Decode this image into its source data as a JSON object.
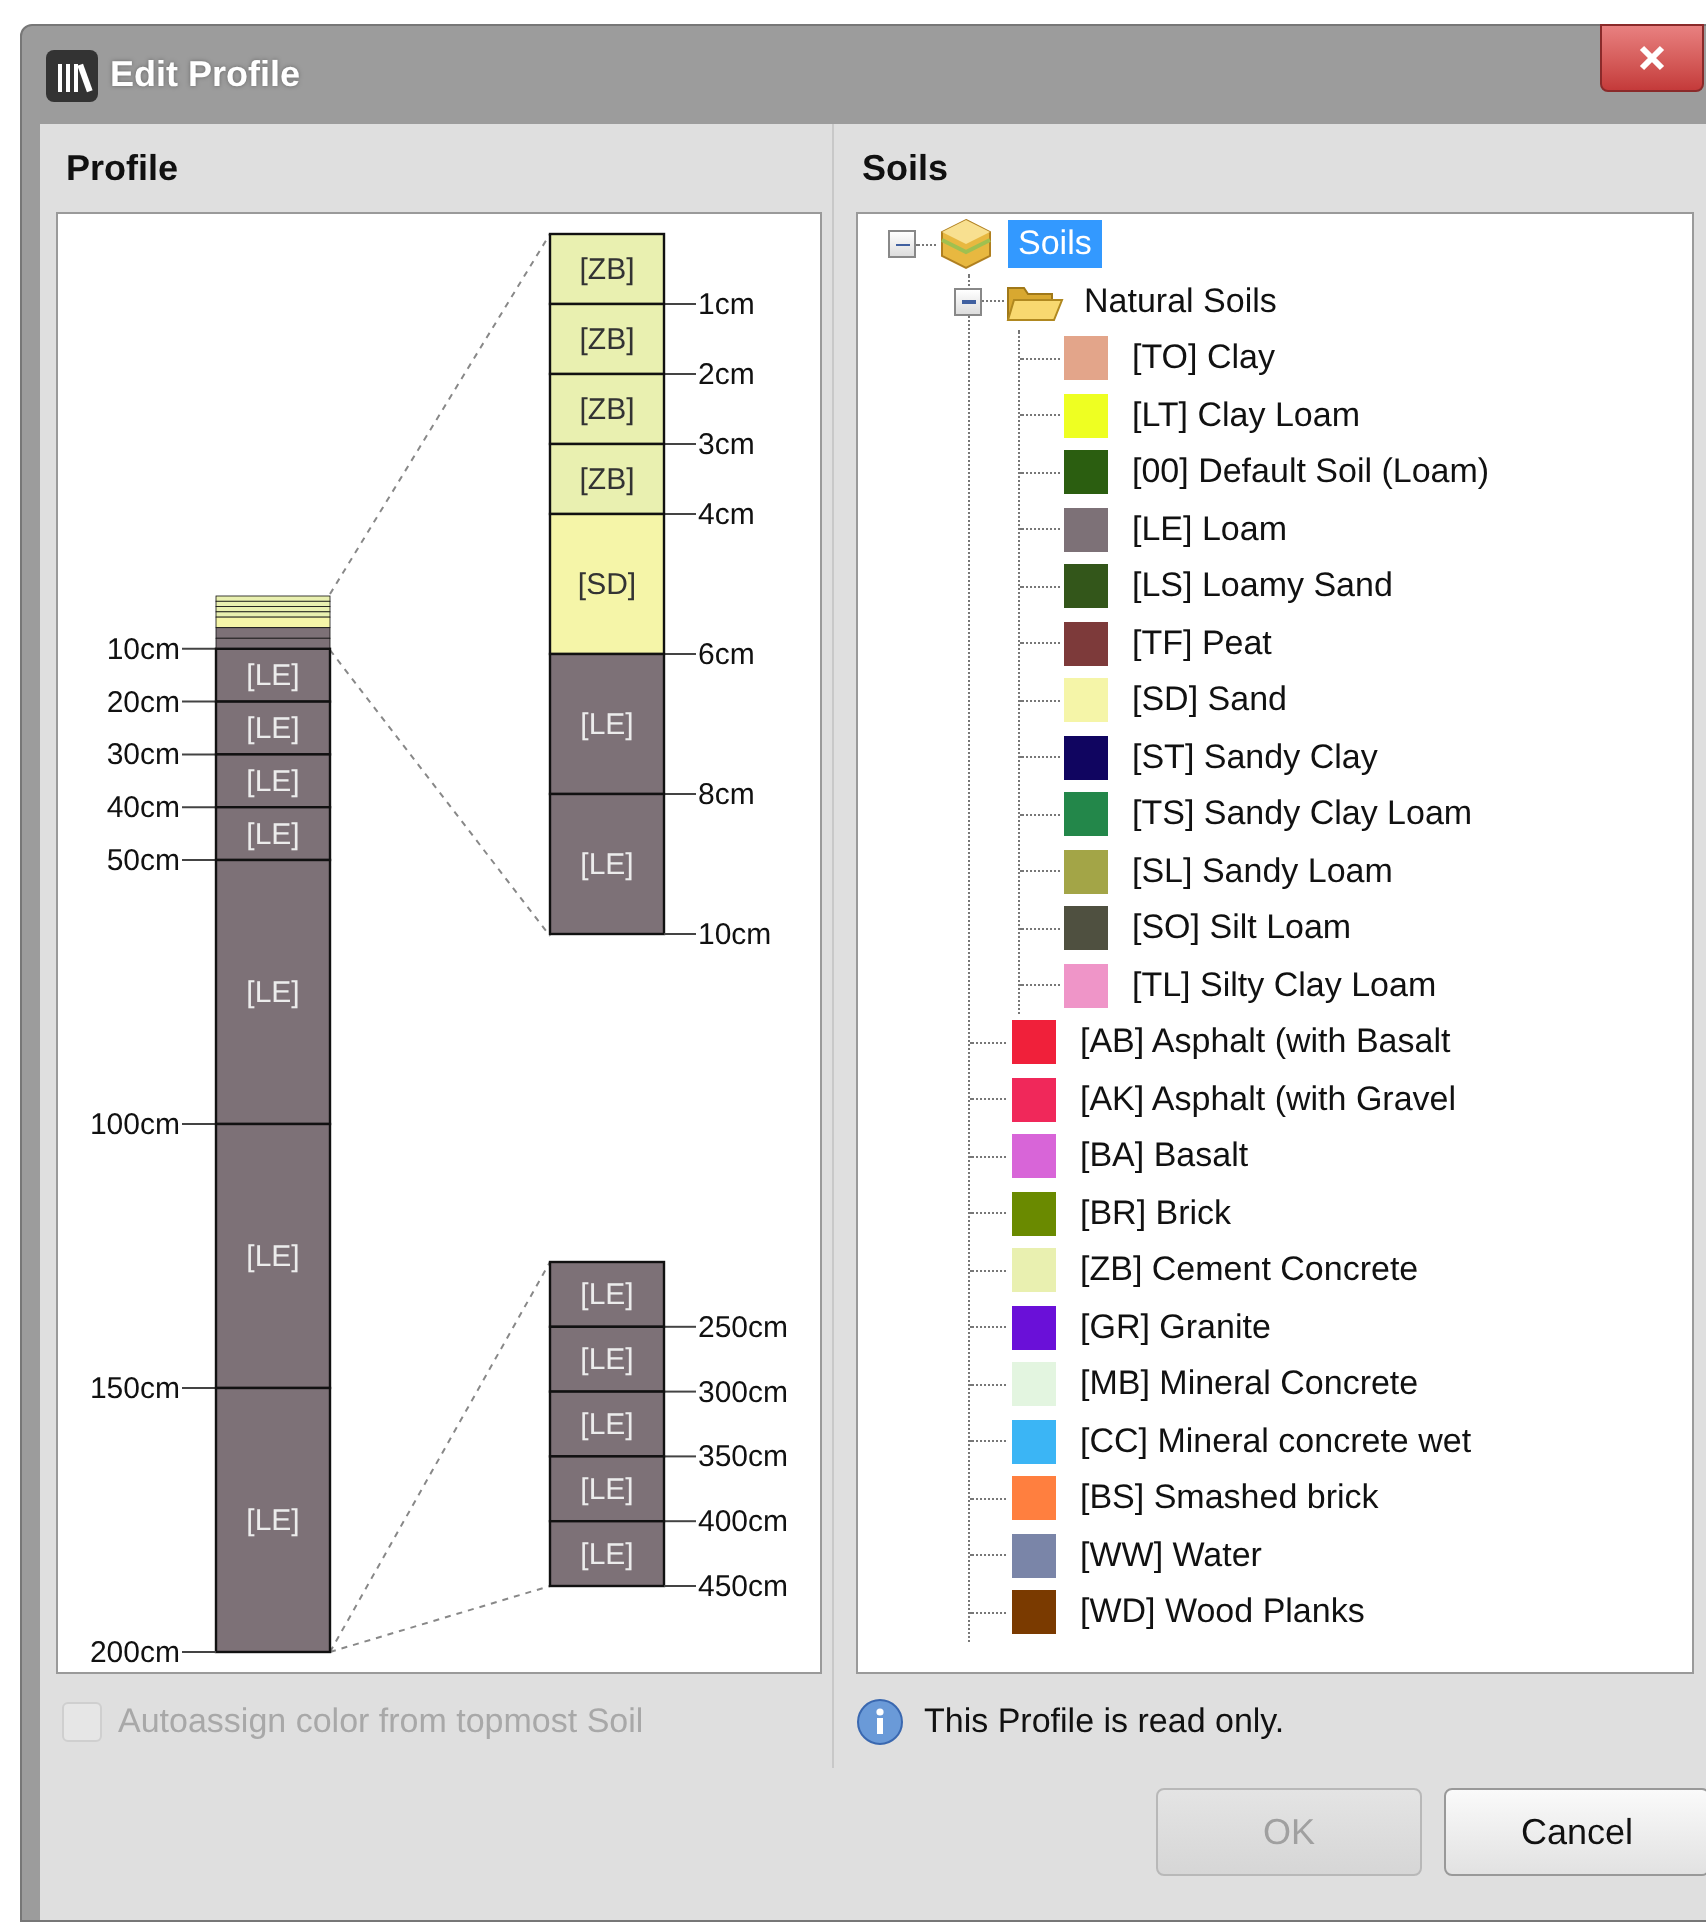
{
  "window": {
    "title": "Edit Profile"
  },
  "profile": {
    "title": "Profile",
    "column": {
      "layers": [
        {
          "color": "#e9f0b0"
        },
        {
          "color": "#e9f0b0"
        },
        {
          "color": "#e9f0b0"
        },
        {
          "color": "#e9f0b0"
        },
        {
          "color": "#f5f5a8"
        },
        {
          "color": "#7d7177"
        },
        {
          "color": "#7d7177",
          "depth": "10cm"
        },
        {
          "color": "#7d7177",
          "label": "[LE]",
          "depth": "20cm"
        },
        {
          "color": "#7d7177",
          "label": "[LE]",
          "depth": "30cm"
        },
        {
          "color": "#7d7177",
          "label": "[LE]",
          "depth": "40cm"
        },
        {
          "color": "#7d7177",
          "label": "[LE]",
          "depth": "50cm"
        },
        {
          "color": "#7d7177",
          "label": "[LE]",
          "depth": "100cm"
        },
        {
          "color": "#7d7177",
          "label": "[LE]",
          "depth": "150cm"
        },
        {
          "color": "#7d7177",
          "label": "[LE]",
          "depth": "200cm"
        }
      ]
    },
    "detail_top": {
      "layers": [
        {
          "color": "#e9f0b0",
          "label": "[ZB]",
          "depth": "1cm"
        },
        {
          "color": "#e9f0b0",
          "label": "[ZB]",
          "depth": "2cm"
        },
        {
          "color": "#e9f0b0",
          "label": "[ZB]",
          "depth": "3cm"
        },
        {
          "color": "#e9f0b0",
          "label": "[ZB]",
          "depth": "4cm"
        },
        {
          "color": "#f5f5a8",
          "label": "[SD]",
          "depth": "6cm"
        },
        {
          "color": "#7d7177",
          "label": "[LE]",
          "depth": "8cm"
        },
        {
          "color": "#7d7177",
          "label": "[LE]",
          "depth": "10cm"
        }
      ]
    },
    "detail_bottom": {
      "layers": [
        {
          "color": "#7d7177",
          "label": "[LE]",
          "depth": "250cm"
        },
        {
          "color": "#7d7177",
          "label": "[LE]",
          "depth": "300cm"
        },
        {
          "color": "#7d7177",
          "label": "[LE]",
          "depth": "350cm"
        },
        {
          "color": "#7d7177",
          "label": "[LE]",
          "depth": "400cm"
        },
        {
          "color": "#7d7177",
          "label": "[LE]",
          "depth": "450cm"
        }
      ]
    },
    "autoassign": {
      "label": "Autoassign color from topmost Soil",
      "checked": false,
      "disabled": true
    }
  },
  "soils": {
    "title": "Soils",
    "message": "This Profile is read only.",
    "tree": [
      {
        "kind": "root",
        "label": "Soils",
        "selected": true,
        "expanded": true,
        "children": [
          {
            "kind": "folder",
            "label": "Natural Soils",
            "selected": false,
            "expanded": true,
            "children": [
              {
                "kind": "soil",
                "label": "[TO] Clay",
                "selected": false,
                "color": "#e3a58a"
              },
              {
                "kind": "soil",
                "label": "[LT] Clay Loam",
                "selected": false,
                "color": "#eeff22"
              },
              {
                "kind": "soil",
                "label": "[00] Default Soil (Loam)",
                "selected": false,
                "color": "#2b5e10"
              },
              {
                "kind": "soil",
                "label": "[LE] Loam",
                "selected": false,
                "color": "#7d7177"
              },
              {
                "kind": "soil",
                "label": "[LS] Loamy Sand",
                "selected": false,
                "color": "#33561a"
              },
              {
                "kind": "soil",
                "label": "[TF] Peat",
                "selected": false,
                "color": "#7d3a3a"
              },
              {
                "kind": "soil",
                "label": "[SD] Sand",
                "selected": false,
                "color": "#f5f5a8"
              },
              {
                "kind": "soil",
                "label": "[ST] Sandy Clay",
                "selected": false,
                "color": "#100560"
              },
              {
                "kind": "soil",
                "label": "[TS] Sandy Clay Loam",
                "selected": false,
                "color": "#23874a"
              },
              {
                "kind": "soil",
                "label": "[SL] Sandy Loam",
                "selected": false,
                "color": "#a3a547"
              },
              {
                "kind": "soil",
                "label": "[SO] Silt Loam",
                "selected": false,
                "color": "#4f5040"
              },
              {
                "kind": "soil",
                "label": "[TL] Silty Clay Loam",
                "selected": false,
                "color": "#ef95c8"
              }
            ]
          },
          {
            "kind": "soil",
            "label": "[AB] Asphalt (with Basalt",
            "selected": false,
            "color": "#f0203a"
          },
          {
            "kind": "soil",
            "label": "[AK] Asphalt (with Gravel",
            "selected": false,
            "color": "#f0285a"
          },
          {
            "kind": "soil",
            "label": "[BA] Basalt",
            "selected": false,
            "color": "#d865d8"
          },
          {
            "kind": "soil",
            "label": "[BR] Brick",
            "selected": false,
            "color": "#6a8a00"
          },
          {
            "kind": "soil",
            "label": "[ZB] Cement Concrete",
            "selected": false,
            "color": "#e9f0b0"
          },
          {
            "kind": "soil",
            "label": "[GR] Granite",
            "selected": false,
            "color": "#6a10d8"
          },
          {
            "kind": "soil",
            "label": "[MB] Mineral Concrete",
            "selected": false,
            "color": "#e3f5e0"
          },
          {
            "kind": "soil",
            "label": "[CC] Mineral concrete wet",
            "selected": false,
            "color": "#3bb5f5"
          },
          {
            "kind": "soil",
            "label": "[BS] Smashed brick",
            "selected": false,
            "color": "#ff7f3f"
          },
          {
            "kind": "soil",
            "label": "[WW] Water",
            "selected": false,
            "color": "#7a85a8"
          },
          {
            "kind": "soil",
            "label": "[WD] Wood Planks",
            "selected": false,
            "color": "#7a3a00"
          }
        ]
      }
    ]
  },
  "buttons": [
    {
      "label": "OK",
      "disabled": true
    },
    {
      "label": "Cancel",
      "disabled": false
    }
  ]
}
